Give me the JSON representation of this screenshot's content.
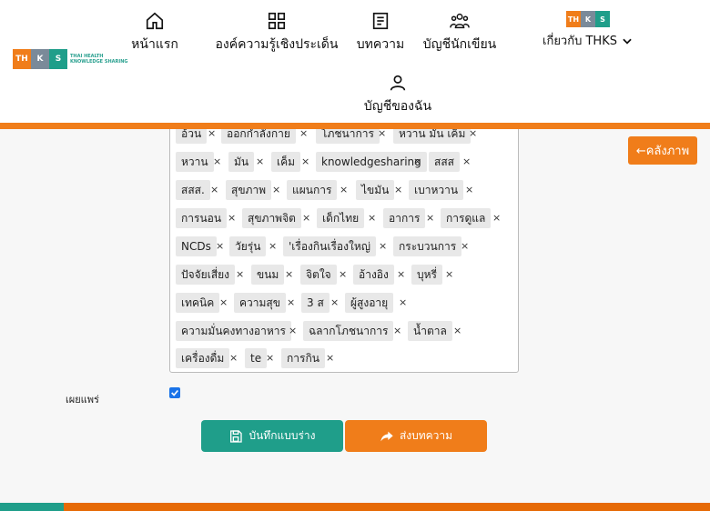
{
  "header": {
    "logo": {
      "letters": [
        "TH",
        "K",
        "S"
      ],
      "text_line1": "THAI HEALTH",
      "text_line2": "KNOWLEDGE SHARING"
    },
    "nav": [
      {
        "label": "หน้าแรก",
        "icon": "home-icon"
      },
      {
        "label": "องค์ความรู้เชิงประเด็น",
        "icon": "grid-icon"
      },
      {
        "label": "บทความ",
        "icon": "document-icon"
      },
      {
        "label": "บัญชีนักเขียน",
        "icon": "users-icon"
      },
      {
        "label": "บัญชีของฉัน",
        "icon": "user-icon"
      }
    ],
    "about": {
      "label": "เกี่ยวกับ THKS",
      "letters": [
        "TH",
        "K",
        "S"
      ]
    }
  },
  "sidebar_button": {
    "label": "←คลังภาพ"
  },
  "tags": [
    "อ้วน",
    "ออกกำลังกาย",
    "โภชนาการ",
    "หวาน มัน เค็ม",
    "หวาน",
    "มัน",
    "เค็ม",
    "knowledgesharing",
    "สสส",
    "สสส.",
    "สุขภาพ",
    "แผนการ",
    "ไขมัน",
    "เบาหวาน",
    "การนอน",
    "สุขภาพจิต",
    "เด็กไทย",
    "อาการ",
    "การดูแล",
    "NCDs",
    "วัยรุ่น",
    "'เรื่องกินเรื่องใหญ่",
    "กระบวนการ",
    "ปัจจัยเสี่ยง",
    "ขนม",
    "จิตใจ",
    "อ้างอิง",
    "บุหรี่",
    "เทคนิค",
    "ความสุข",
    "3 ส",
    "ผู้สูงอายุ",
    "ความมั่นคงทางอาหาร",
    "ฉลากโภชนาการ",
    "น้ำตาล",
    "เครื่องดื่ม",
    "te",
    "การกิน"
  ],
  "tag_remove_symbol": "×",
  "publish": {
    "label": "เผยแพร่",
    "checked": true
  },
  "buttons": {
    "save_draft": "บันทึกแบบร่าง",
    "submit": "ส่งบทความ"
  },
  "colors": {
    "orange": "#f07d1a",
    "teal": "#1f9e8a"
  }
}
